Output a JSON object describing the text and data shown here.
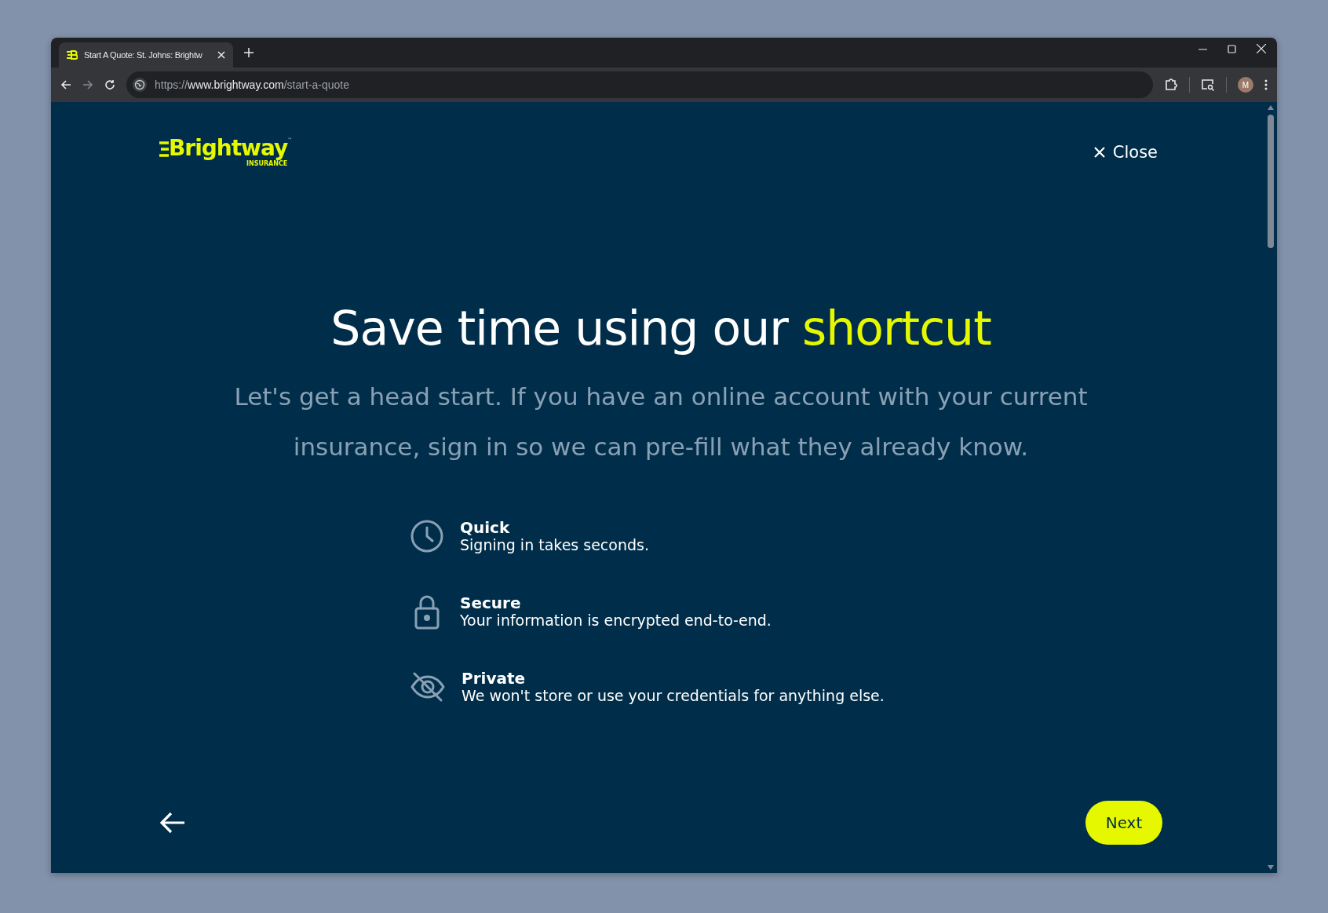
{
  "browser": {
    "tab": {
      "title": "Start A Quote: St. Johns: Brightw",
      "selected": true
    },
    "url": {
      "scheme": "https://",
      "host": "www.brightway.com",
      "path": "/start-a-quote"
    },
    "avatar": "M"
  },
  "logo": {
    "name": "Brightway",
    "tagline": "INSURANCE",
    "mark": "™"
  },
  "close": {
    "label": "Close"
  },
  "heading": {
    "text": "Save time using our ",
    "highlight": "shortcut"
  },
  "subtitle": "Let's get a head start. If you have an online account with your current insurance, sign in so we can pre-fill what they already know.",
  "features": [
    {
      "kind": "clock",
      "title": "Quick",
      "text": "Signing in takes seconds."
    },
    {
      "kind": "lock",
      "title": "Secure",
      "text": "Your information is encrypted end-to-end."
    },
    {
      "kind": "eye-off",
      "title": "Private",
      "text": "We won't store or use your credentials for anything else."
    }
  ],
  "next": {
    "label": "Next"
  }
}
